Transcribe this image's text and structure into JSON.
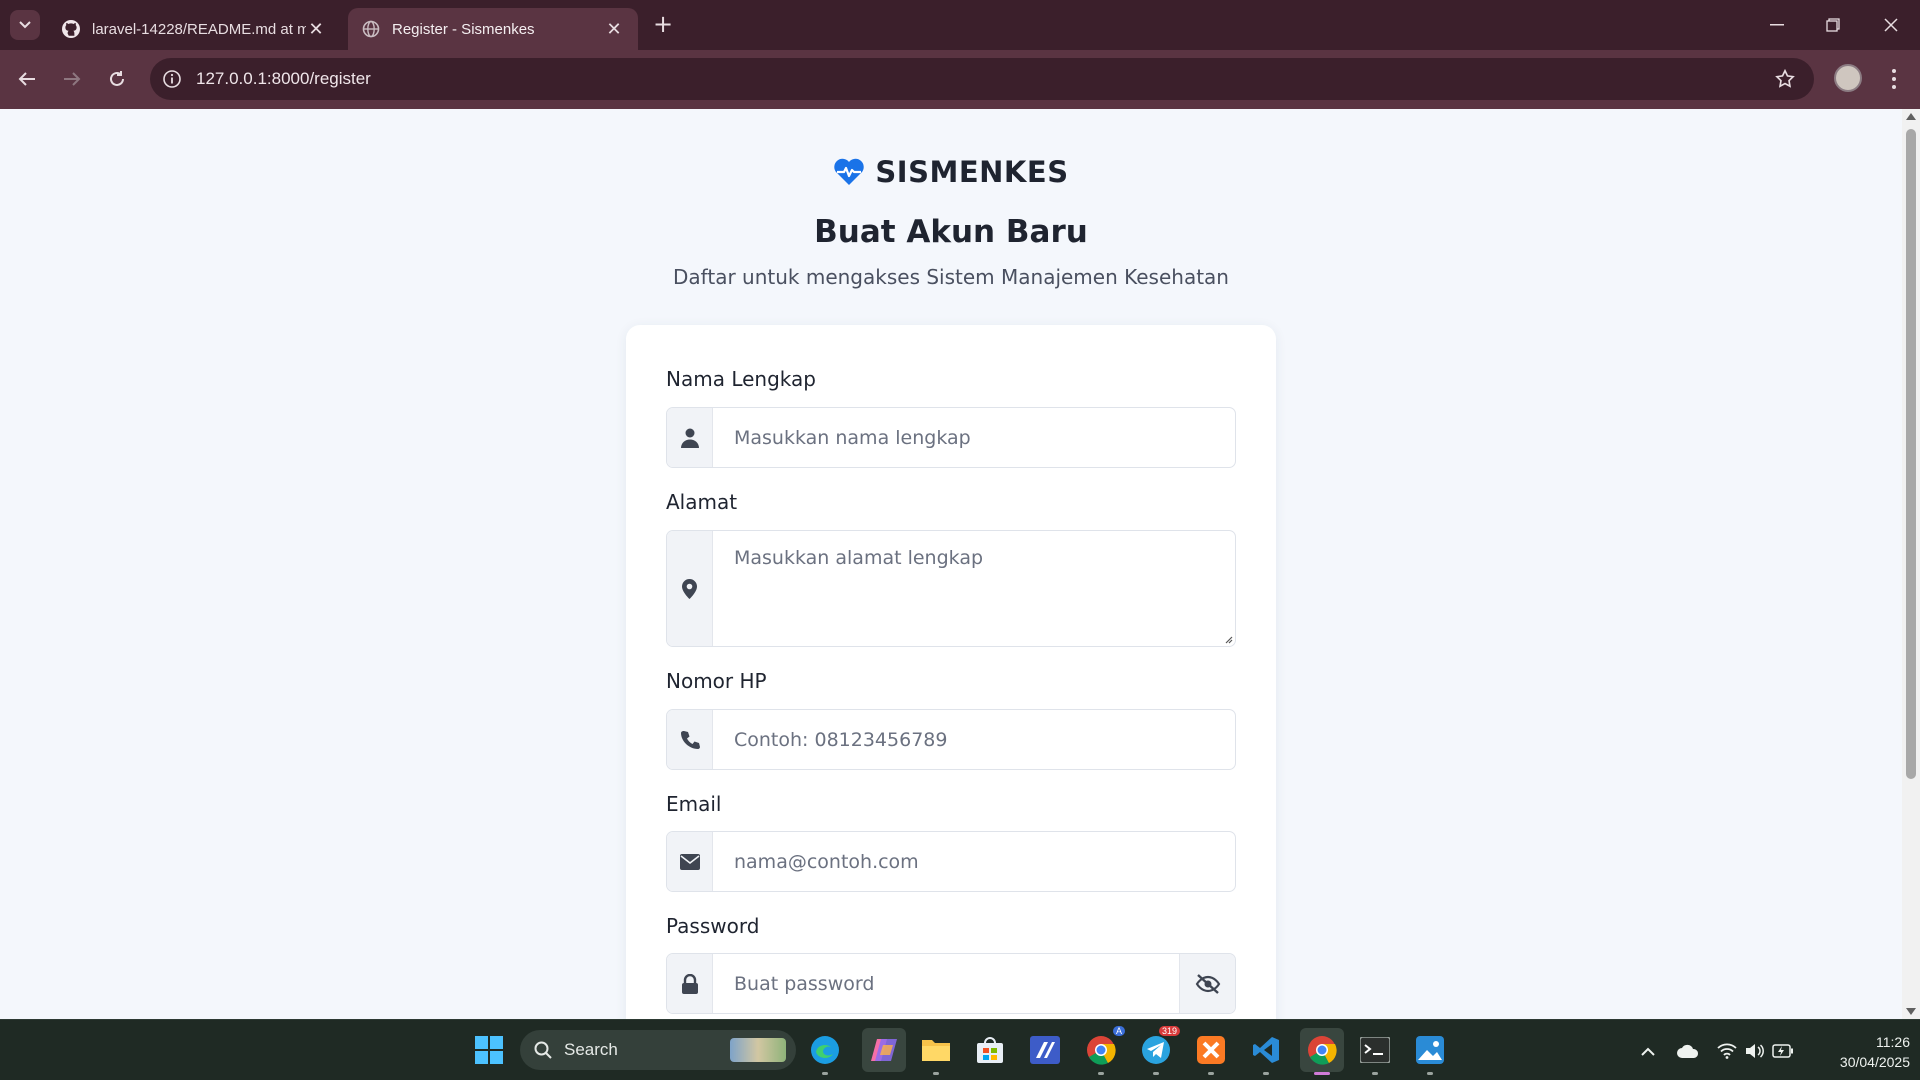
{
  "browser": {
    "tabs": [
      {
        "title": "laravel-14228/README.md at m",
        "icon": "github-icon",
        "active": false
      },
      {
        "title": "Register - Sismenkes",
        "icon": "globe-icon",
        "active": true
      }
    ],
    "url": "127.0.0.1:8000/register"
  },
  "page": {
    "brand": "SISMENKES",
    "brand_icon": "heartbeat-icon",
    "title": "Buat Akun Baru",
    "subtitle": "Daftar untuk mengakses Sistem Manajemen Kesehatan",
    "accent_color": "#1a73e8"
  },
  "form": {
    "name": {
      "label": "Nama Lengkap",
      "placeholder": "Masukkan nama lengkap",
      "icon": "user-icon"
    },
    "address": {
      "label": "Alamat",
      "placeholder": "Masukkan alamat lengkap",
      "icon": "map-pin-icon"
    },
    "phone": {
      "label": "Nomor HP",
      "placeholder": "Contoh: 08123456789",
      "icon": "phone-icon"
    },
    "email": {
      "label": "Email",
      "placeholder": "nama@contoh.com",
      "icon": "envelope-icon"
    },
    "password": {
      "label": "Password",
      "placeholder": "Buat password",
      "icon": "lock-icon",
      "toggle_icon": "eye-slash-icon"
    }
  },
  "taskbar": {
    "search_label": "Search",
    "telegram_badge": "319",
    "chrome_badge": "A",
    "time": "11:26",
    "date": "30/04/2025"
  }
}
